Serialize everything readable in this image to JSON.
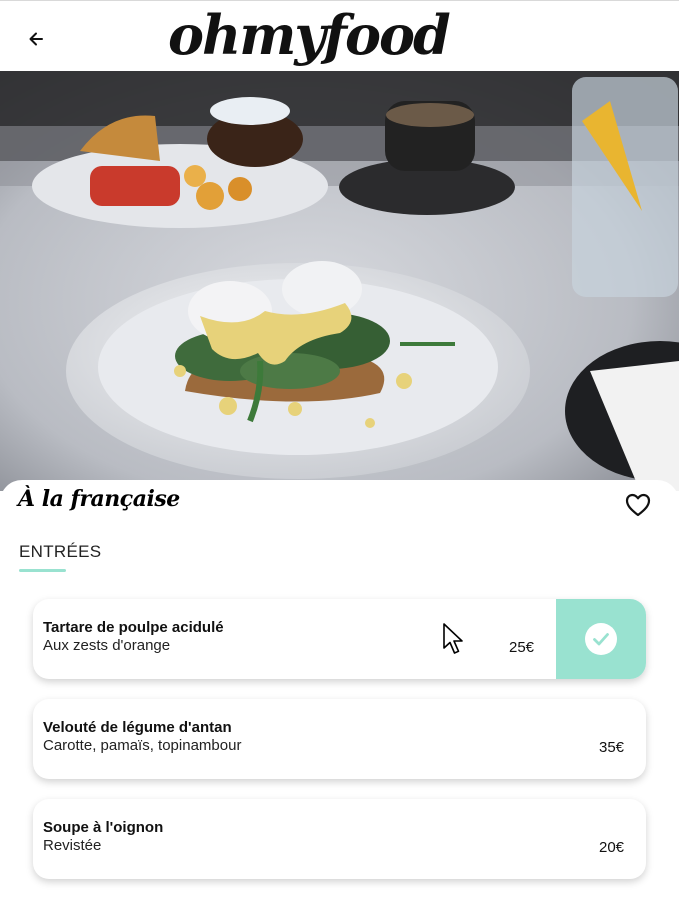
{
  "header": {
    "logo_text": "ohmyfood",
    "back_icon": "arrow-left-icon"
  },
  "hero": {
    "image": "eggs-benedict-plate-photo"
  },
  "restaurant": {
    "title": "À la française",
    "favorite_icon": "heart-outline-icon"
  },
  "section": {
    "title": "ENTRÉES"
  },
  "dishes": [
    {
      "name": "Tartare de poulpe acidulé",
      "description": "Aux zests d'orange",
      "price": "25€",
      "selected": true
    },
    {
      "name": "Velouté de légume d'antan",
      "description": "Carotte, pamaïs, topinambour",
      "price": "35€",
      "selected": false
    },
    {
      "name": "Soupe à l'oignon",
      "description": "Revistée",
      "price": "20€",
      "selected": false
    }
  ],
  "colors": {
    "accent": "#99e2d0",
    "text": "#111111",
    "background": "#ffffff"
  }
}
